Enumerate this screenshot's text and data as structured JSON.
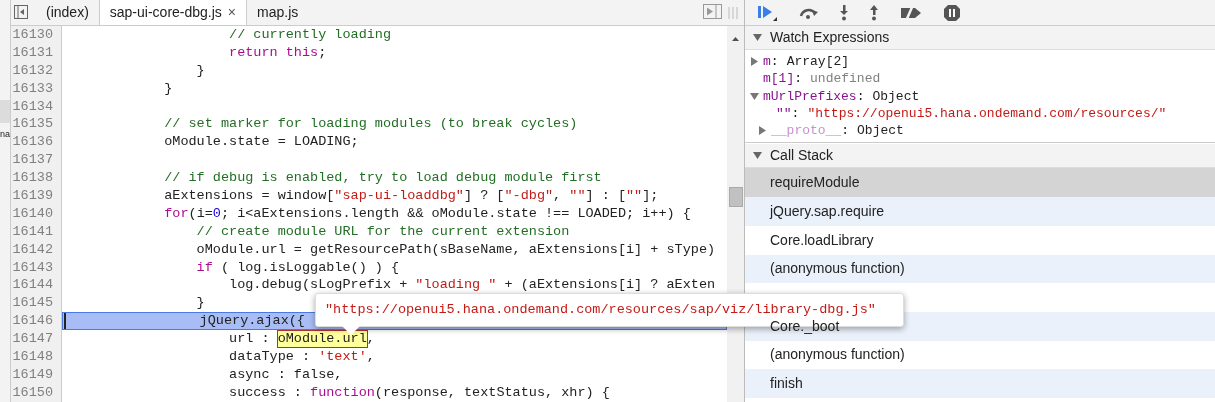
{
  "navigator": {
    "items": [
      {
        "selected": true
      },
      {
        "label": "na",
        "selected": false
      }
    ]
  },
  "tabs": [
    {
      "label": "(index)",
      "selected": false,
      "closable": false
    },
    {
      "label": "sap-ui-core-dbg.js",
      "selected": true,
      "closable": true
    },
    {
      "label": "map.js",
      "selected": false,
      "closable": false
    }
  ],
  "close_glyph": "×",
  "code": {
    "lines": [
      {
        "number": "16130",
        "selected": false,
        "tokens": [
          {
            "kind": "comment",
            "text": "                    // currently loading"
          }
        ]
      },
      {
        "number": "16131",
        "selected": false,
        "tokens": [
          {
            "kind": "keyword",
            "text": "                    return this"
          },
          {
            "kind": "plain",
            "text": ";"
          }
        ]
      },
      {
        "number": "16132",
        "selected": false,
        "tokens": [
          {
            "kind": "plain",
            "text": "                }"
          }
        ]
      },
      {
        "number": "16133",
        "selected": false,
        "tokens": [
          {
            "kind": "plain",
            "text": "            }"
          }
        ]
      },
      {
        "number": "16134",
        "selected": false
      },
      {
        "number": "16135",
        "selected": false,
        "tokens": [
          {
            "kind": "comment",
            "text": "            // set marker for loading modules (to break cycles)"
          }
        ]
      },
      {
        "number": "16136",
        "selected": false,
        "tokens": [
          {
            "kind": "plain",
            "text": "            oModule.state = LOADING;"
          }
        ]
      },
      {
        "number": "16137",
        "selected": false
      },
      {
        "number": "16138",
        "selected": false,
        "tokens": [
          {
            "kind": "comment",
            "text": "            // if debug is enabled, try to load debug module first"
          }
        ]
      },
      {
        "number": "16139",
        "selected": false,
        "tokens": [
          {
            "kind": "plain",
            "text": "            aExtensions = window["
          },
          {
            "kind": "string",
            "text": "\"sap-ui-loaddbg\""
          },
          {
            "kind": "plain",
            "text": "] ? ["
          },
          {
            "kind": "string",
            "text": "\"-dbg\""
          },
          {
            "kind": "plain",
            "text": ", "
          },
          {
            "kind": "string",
            "text": "\"\""
          },
          {
            "kind": "plain",
            "text": "] : ["
          },
          {
            "kind": "string",
            "text": "\"\""
          },
          {
            "kind": "plain",
            "text": "];"
          }
        ]
      },
      {
        "number": "16140",
        "selected": false,
        "tokens": [
          {
            "kind": "keyword",
            "text": "            for"
          },
          {
            "kind": "plain",
            "text": "(i="
          },
          {
            "kind": "number",
            "text": "0"
          },
          {
            "kind": "plain",
            "text": "; i<aExtensions.length && oModule.state !== LOADED; i++) {"
          }
        ]
      },
      {
        "number": "16141",
        "selected": false,
        "tokens": [
          {
            "kind": "comment",
            "text": "                // create module URL for the current extension"
          }
        ]
      },
      {
        "number": "16142",
        "selected": false,
        "tokens": [
          {
            "kind": "plain",
            "text": "                oModule.url = getResourcePath(sBaseName, aExtensions[i] + sType)"
          }
        ]
      },
      {
        "number": "16143",
        "selected": false,
        "tokens": [
          {
            "kind": "keyword",
            "text": "                if"
          },
          {
            "kind": "plain",
            "text": " ( log.isLoggable() ) {"
          }
        ]
      },
      {
        "number": "16144",
        "selected": false,
        "tokens": [
          {
            "kind": "plain",
            "text": "                    log.debug(sLogPrefix + "
          },
          {
            "kind": "string",
            "text": "\"loading \""
          },
          {
            "kind": "plain",
            "text": " + (aExtensions[i] ? aExten"
          }
        ]
      },
      {
        "number": "16145",
        "selected": false,
        "tokens": [
          {
            "kind": "plain",
            "text": "                }"
          }
        ]
      },
      {
        "number": "16146",
        "selected": true,
        "tokens": [
          {
            "kind": "plain",
            "text": "                jQuery.ajax({"
          }
        ]
      },
      {
        "number": "16147",
        "selected": false,
        "tokens": [
          {
            "kind": "plain",
            "text": "                    url : "
          },
          {
            "kind": "highlight",
            "text": "oModule.url"
          },
          {
            "kind": "plain",
            "text": ","
          }
        ]
      },
      {
        "number": "16148",
        "selected": false,
        "tokens": [
          {
            "kind": "plain",
            "text": "                    dataType : "
          },
          {
            "kind": "string",
            "text": "'text'"
          },
          {
            "kind": "plain",
            "text": ","
          }
        ]
      },
      {
        "number": "16149",
        "selected": false,
        "tokens": [
          {
            "kind": "plain",
            "text": "                    async : false,"
          }
        ]
      },
      {
        "number": "16150",
        "selected": false,
        "tokens": [
          {
            "kind": "plain",
            "text": "                    success : "
          },
          {
            "kind": "keyword",
            "text": "function"
          },
          {
            "kind": "plain",
            "text": "(response, textStatus, xhr) {"
          }
        ]
      }
    ]
  },
  "tooltip": {
    "text": "\"https://openui5.hana.ondemand.com/resources/sap/viz/library-dbg.js\""
  },
  "watch": {
    "title": "Watch Expressions",
    "expanded": true,
    "separator": ":",
    "items": [
      {
        "key": "m",
        "value": "Array[2]",
        "kind": "object",
        "expandable": true,
        "expanded": false
      },
      {
        "key": "m[1]",
        "value": "undefined",
        "kind": "undefined",
        "expandable": false
      },
      {
        "key": "mUrlPrefixes",
        "value": "Object",
        "kind": "object",
        "expandable": true,
        "expanded": true,
        "children": [
          {
            "key": "\"\"",
            "value": "\"https://openui5.hana.ondemand.com/resources/\"",
            "kind": "string",
            "expandable": false
          },
          {
            "key": "__proto__",
            "value": "Object",
            "kind": "proto",
            "expandable": true,
            "expanded": false
          }
        ]
      }
    ]
  },
  "call_stack": {
    "title": "Call Stack",
    "expanded": true,
    "frames": [
      {
        "label": "requireModule",
        "selected": true
      },
      {
        "label": "jQuery.sap.require",
        "selected": false
      },
      {
        "label": "Core.loadLibrary",
        "selected": false
      },
      {
        "label": "(anonymous function)",
        "selected": false
      },
      {
        "selected": false
      },
      {
        "label": "Core._boot",
        "selected": false
      },
      {
        "label": "(anonymous function)",
        "selected": false
      },
      {
        "label": "finish",
        "selected": false
      }
    ]
  }
}
